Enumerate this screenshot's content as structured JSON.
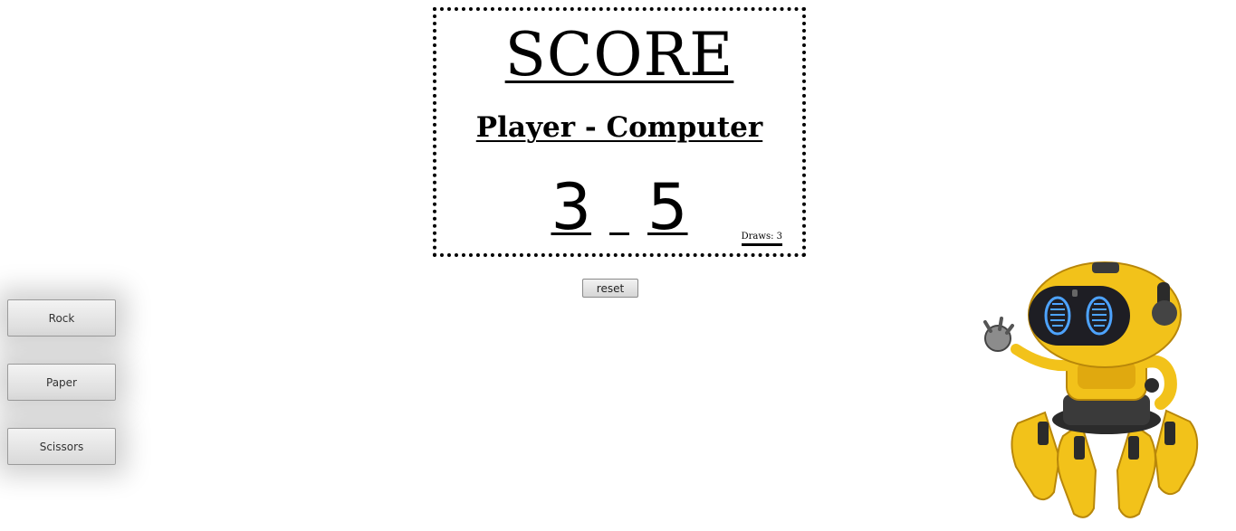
{
  "scoreboard": {
    "title": "SCORE",
    "subtitle": "Player - Computer",
    "player_score": "3",
    "computer_score": "5",
    "draws_label": "Draws: 3"
  },
  "controls": {
    "reset_label": "reset"
  },
  "choices": {
    "rock": "Rock",
    "paper": "Paper",
    "scissors": "Scissors"
  },
  "colors": {
    "robot_body": "#f2c21a",
    "robot_dark": "#2b2b2b",
    "robot_eye": "#4da3ff"
  }
}
